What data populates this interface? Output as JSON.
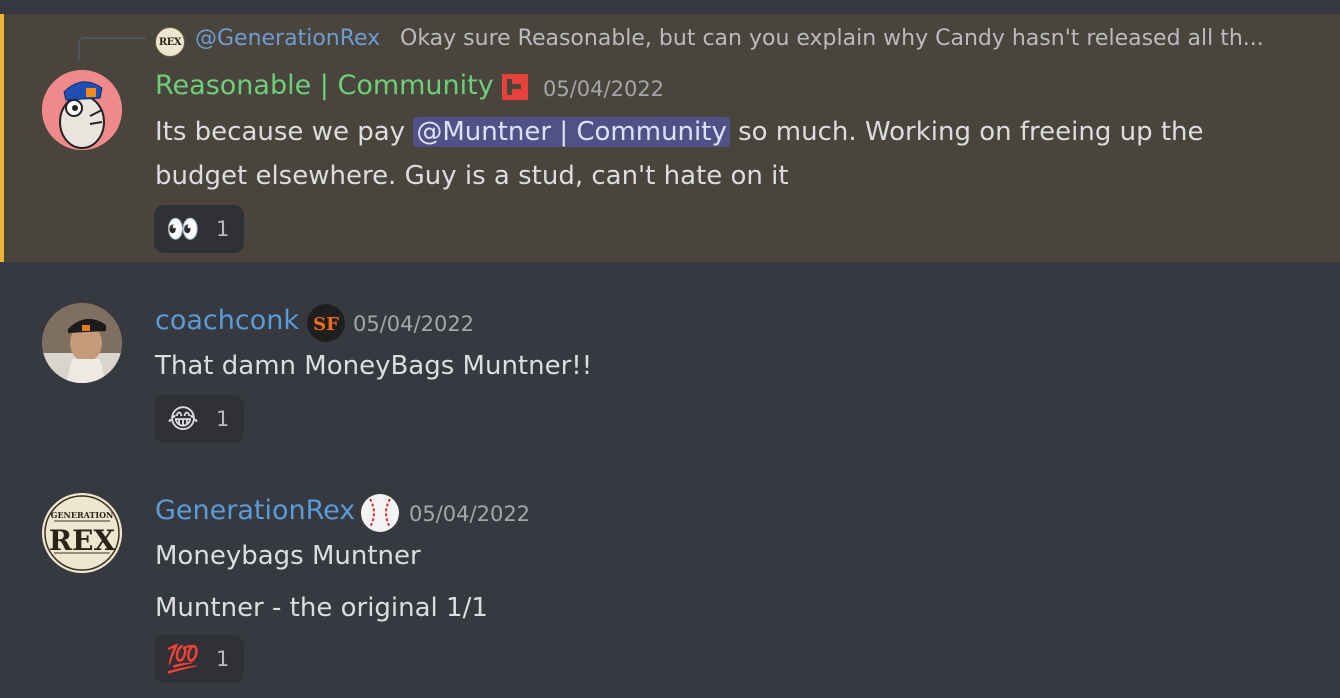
{
  "messages": [
    {
      "reply": {
        "avatar_text": "REX",
        "username": "@GenerationRex",
        "text": "Okay sure Reasonable, but can you explain why Candy hasn't released all th..."
      },
      "author": "Reasonable | Community",
      "author_color": "#6ece7a",
      "badge_icon": "red-square-role-icon",
      "timestamp": "05/04/2022",
      "text_before_mention": "Its because we pay",
      "mention": "@Muntner | Community",
      "text_after_mention": "so much. Working on freeing up the",
      "text_line2": "budget elsewhere. Guy is a stud, can't hate on it",
      "reaction": {
        "emoji": "👀",
        "emoji_name": "eyes-emoji",
        "count": "1"
      },
      "highlighted": true
    },
    {
      "author": "coachconk",
      "author_color": "#5b9bd8",
      "badge_icon": "sf-giants-logo-icon",
      "timestamp": "05/04/2022",
      "text": "That damn MoneyBags Muntner!!",
      "reaction": {
        "emoji": "😂",
        "emoji_name": "joy-emoji",
        "count": "1"
      }
    },
    {
      "author": "GenerationRex",
      "author_color": "#5b9bd8",
      "avatar_text_top": "GENERATION",
      "avatar_text_main": "REX",
      "badge_icon": "baseball-icon",
      "timestamp": "05/04/2022",
      "text_line1": "Moneybags Muntner",
      "text_line2": "Muntner - the original 1/1",
      "reaction": {
        "emoji": "💯",
        "emoji_name": "hundred-points-emoji",
        "count": "1"
      }
    }
  ]
}
